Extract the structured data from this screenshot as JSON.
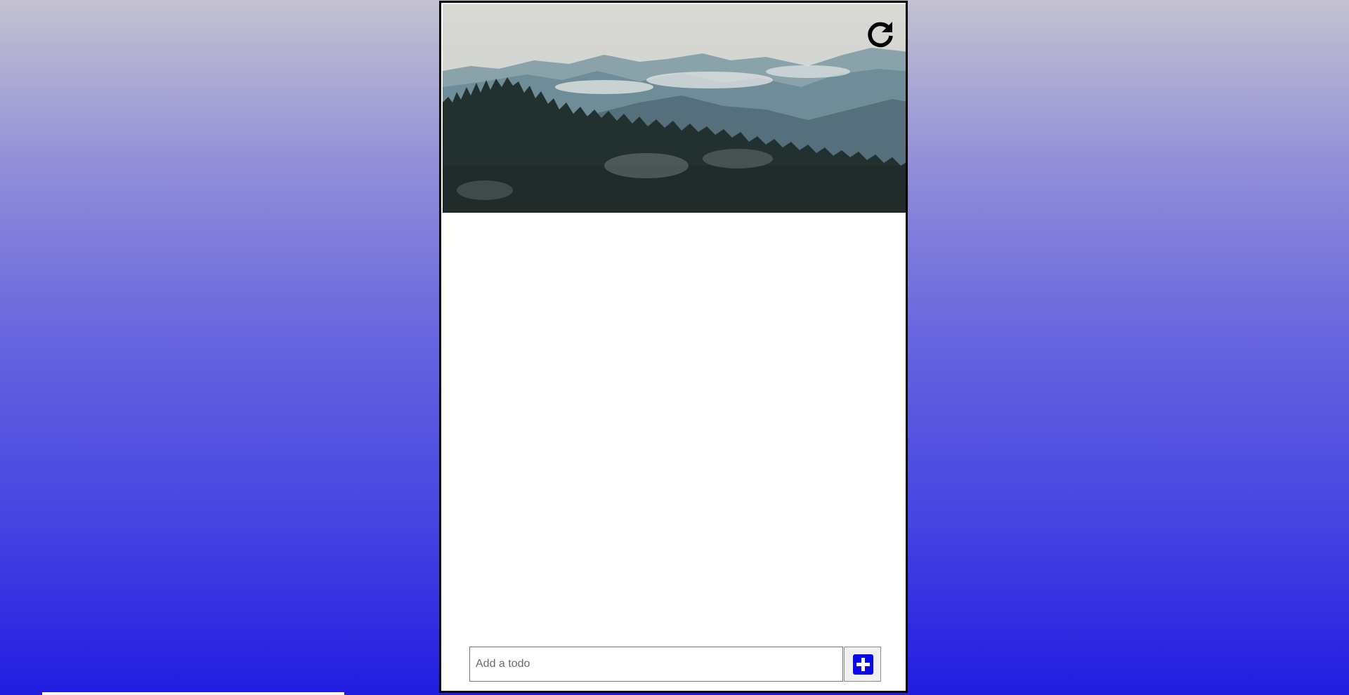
{
  "header": {
    "image_alt": "",
    "refresh_icon": "refresh-icon"
  },
  "todo_list": {
    "items": []
  },
  "add_form": {
    "input_value": "",
    "input_placeholder": "Add a todo",
    "add_icon": "plus-icon"
  },
  "colors": {
    "background_top": "#c3c2d1",
    "background_bottom": "#221ce1",
    "add_button_accent": "#0a0ae6",
    "card_border": "#000000"
  }
}
